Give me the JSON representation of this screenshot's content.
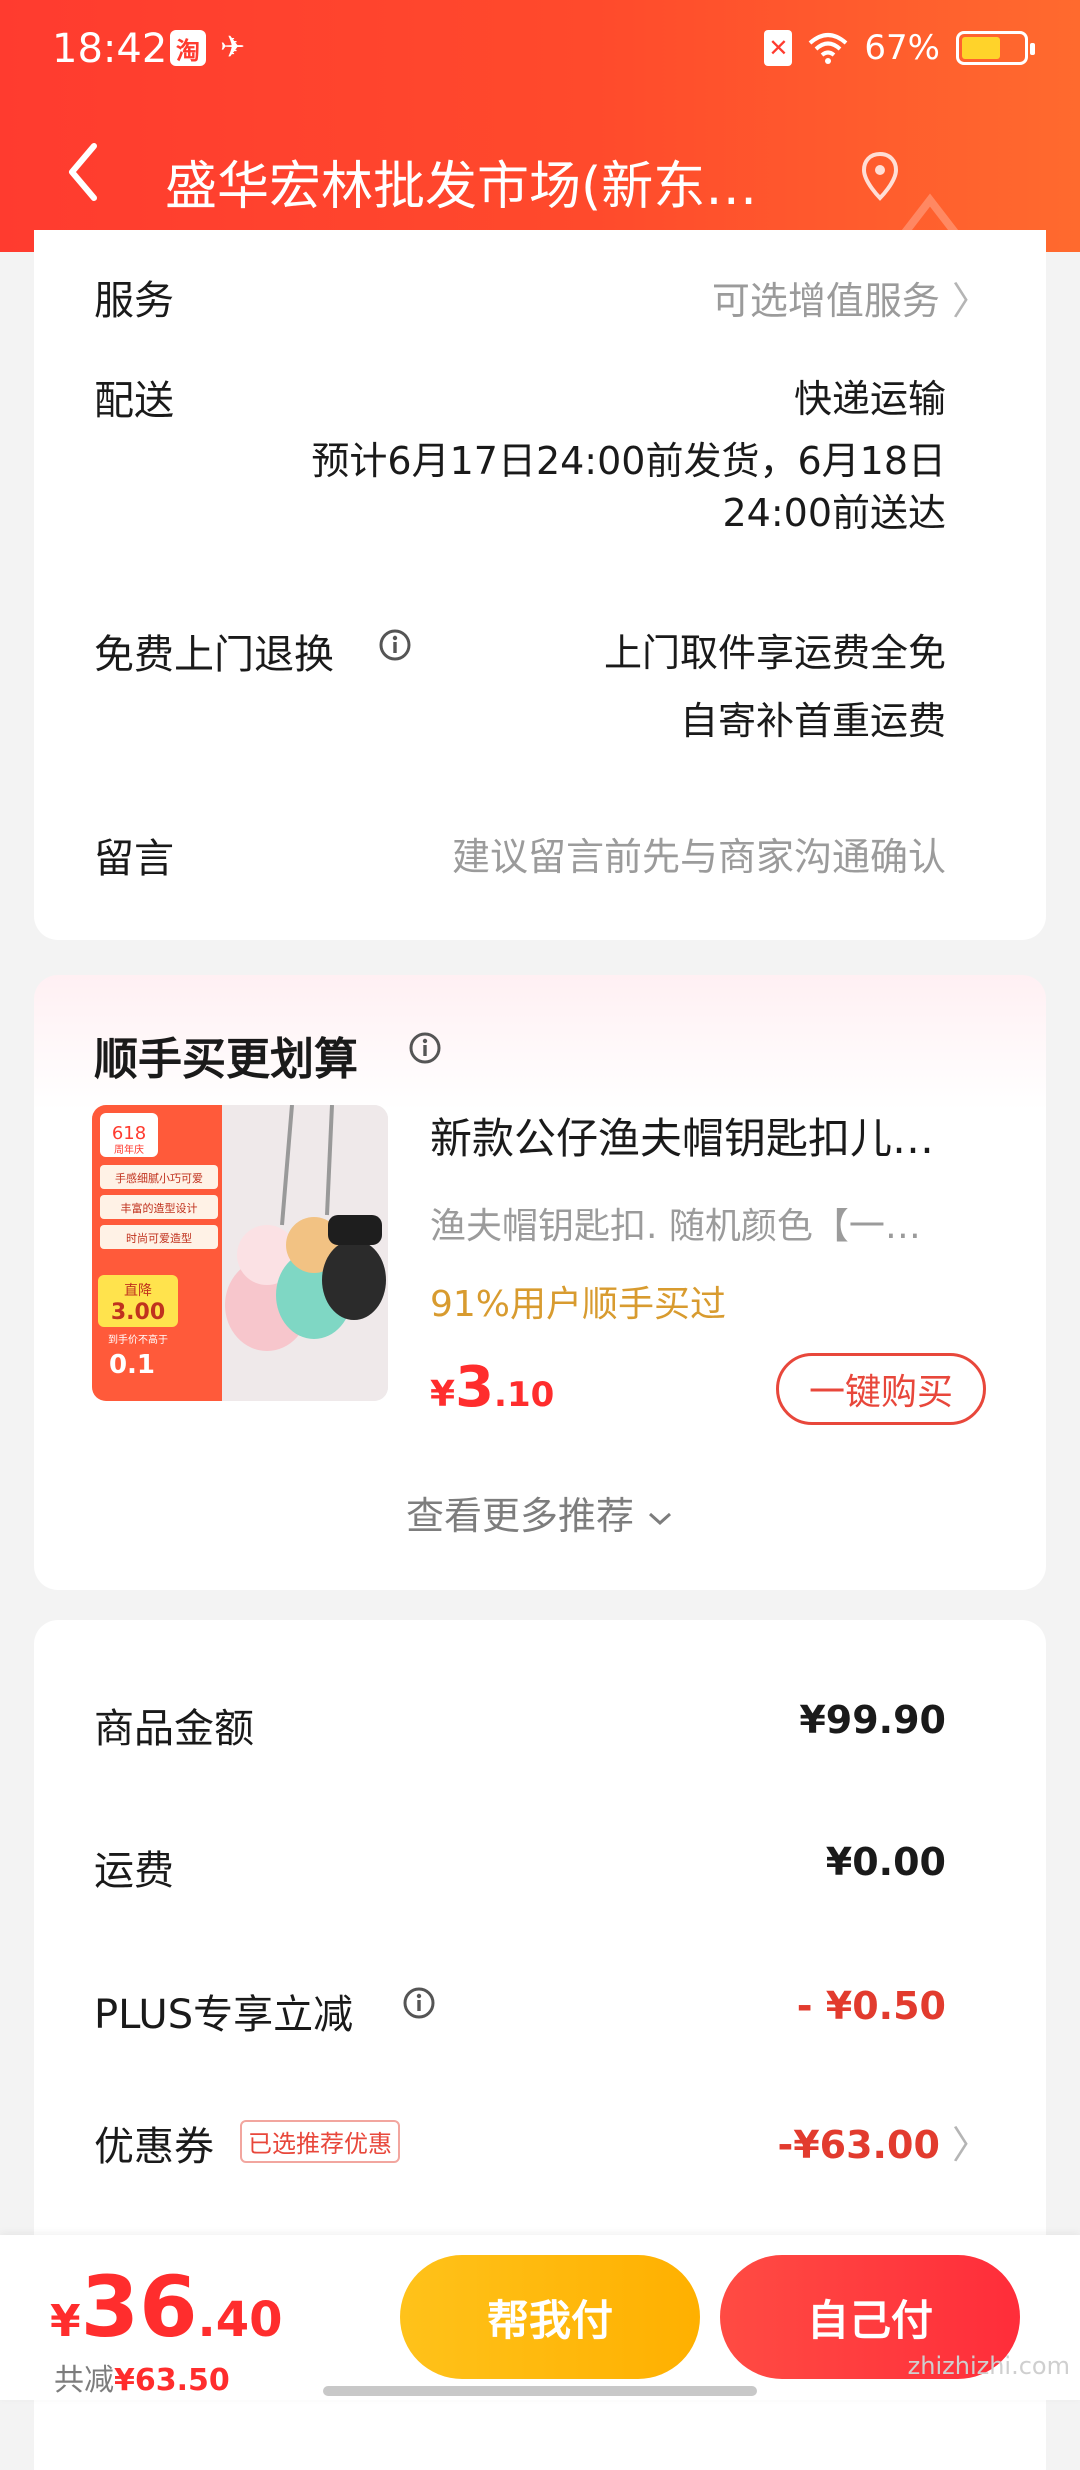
{
  "status": {
    "time": "18:42",
    "battery": "67%",
    "battery_level": 0.67
  },
  "nav": {
    "title": "盛华宏林批发市场(新东…"
  },
  "order_info": {
    "service_label": "服务",
    "service_value": "可选增值服务",
    "delivery_label": "配送",
    "delivery_method": "快递运输",
    "delivery_line1": "预计6月17日24:00前发货，6月18日",
    "delivery_line2": "24:00前送达",
    "return_label": "免费上门退换",
    "return_line1": "上门取件享运费全免",
    "return_line2": "自寄补首重运费",
    "message_label": "留言",
    "message_placeholder": "建议留言前先与商家沟通确认"
  },
  "recommend": {
    "section_title": "顺手买更划算",
    "item_title": "新款公仔渔夫帽钥匙扣儿…",
    "item_sub": "渔夫帽钥匙扣.  随机颜色【一…",
    "item_stat": "91%用户顺手买过",
    "price_currency": "¥",
    "price_int": "3",
    "price_dec": ".10",
    "buy_label": "一键购买",
    "more_label": "查看更多推荐",
    "thumb_badge": "618",
    "thumb_sub": "周年庆",
    "thumb_lines": [
      "手感细腻小巧可爱",
      "丰富的造型设计",
      "时尚可爱造型"
    ],
    "thumb_promo_label": "直降",
    "thumb_promo_amount": "3.00",
    "thumb_promo_small": "到手价不高于",
    "thumb_promo_price": "0.1"
  },
  "summary": {
    "goods_label": "商品金额",
    "goods_value": "¥99.90",
    "shipping_label": "运费",
    "shipping_value": "¥0.00",
    "plus_label": "PLUS专享立减",
    "plus_value": "- ¥0.50",
    "coupon_label": "优惠券",
    "coupon_badge": "已选推荐优惠",
    "coupon_value": "-¥63.00"
  },
  "bottom": {
    "total_currency": "¥",
    "total_int": "36",
    "total_dec": ".40",
    "saved_prefix": "共减",
    "saved_value": "¥63.50",
    "help_label": "帮我付",
    "self_label": "自己付",
    "watermark": "zhizhizhi.com"
  },
  "colors": {
    "accent": "#ff3b2f",
    "price": "#ff2d2d",
    "help_btn": "#ffb000",
    "stat": "#d89b2f"
  },
  "icons": [
    "back-icon",
    "location-icon",
    "info-icon",
    "chevron-right-icon",
    "chevron-down-icon"
  ]
}
